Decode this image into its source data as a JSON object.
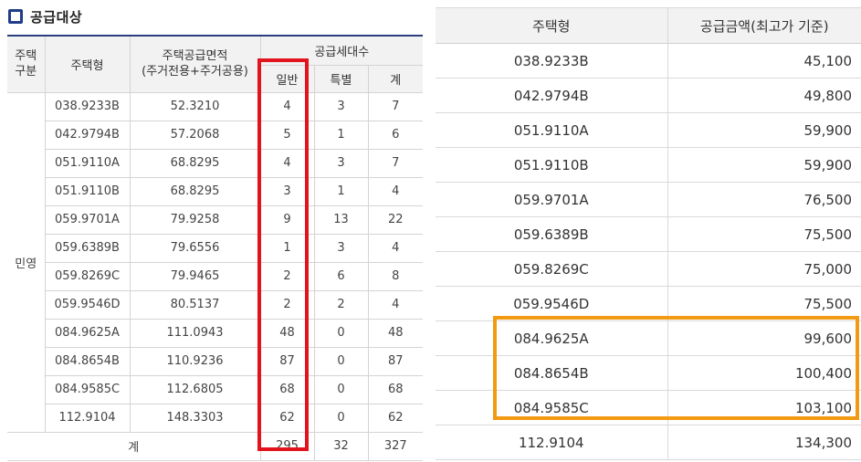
{
  "left": {
    "title": "공급대상",
    "headers": {
      "category": "주택\n구분",
      "type": "주택형",
      "area": "주택공급면적\n(주거전용+주거공용)",
      "units": "공급세대수",
      "general": "일반",
      "special": "특별",
      "total": "계"
    },
    "group_label": "민영",
    "rows": [
      {
        "type": "038.9233B",
        "area": "52.3210",
        "general": "4",
        "special": "3",
        "total": "7"
      },
      {
        "type": "042.9794B",
        "area": "57.2068",
        "general": "5",
        "special": "1",
        "total": "6"
      },
      {
        "type": "051.9110A",
        "area": "68.8295",
        "general": "4",
        "special": "3",
        "total": "7"
      },
      {
        "type": "051.9110B",
        "area": "68.8295",
        "general": "3",
        "special": "1",
        "total": "4"
      },
      {
        "type": "059.9701A",
        "area": "79.9258",
        "general": "9",
        "special": "13",
        "total": "22"
      },
      {
        "type": "059.6389B",
        "area": "79.6556",
        "general": "1",
        "special": "3",
        "total": "4"
      },
      {
        "type": "059.8269C",
        "area": "79.9465",
        "general": "2",
        "special": "6",
        "total": "8"
      },
      {
        "type": "059.9546D",
        "area": "80.5137",
        "general": "2",
        "special": "2",
        "total": "4"
      },
      {
        "type": "084.9625A",
        "area": "111.0943",
        "general": "48",
        "special": "0",
        "total": "48"
      },
      {
        "type": "084.8654B",
        "area": "110.9236",
        "general": "87",
        "special": "0",
        "total": "87"
      },
      {
        "type": "084.9585C",
        "area": "112.6805",
        "general": "68",
        "special": "0",
        "total": "68"
      },
      {
        "type": "112.9104",
        "area": "148.3303",
        "general": "62",
        "special": "0",
        "total": "62"
      }
    ],
    "footer": {
      "label": "계",
      "general": "295",
      "special": "32",
      "total": "327"
    }
  },
  "right": {
    "headers": {
      "type": "주택형",
      "price": "공급금액(최고가 기준)"
    },
    "rows": [
      {
        "type": "038.9233B",
        "price": "45,100"
      },
      {
        "type": "042.9794B",
        "price": "49,800"
      },
      {
        "type": "051.9110A",
        "price": "59,900"
      },
      {
        "type": "051.9110B",
        "price": "59,900"
      },
      {
        "type": "059.9701A",
        "price": "76,500"
      },
      {
        "type": "059.6389B",
        "price": "75,500"
      },
      {
        "type": "059.8269C",
        "price": "75,000"
      },
      {
        "type": "059.9546D",
        "price": "75,500"
      },
      {
        "type": "084.9625A",
        "price": "99,600"
      },
      {
        "type": "084.8654B",
        "price": "100,400"
      },
      {
        "type": "084.9585C",
        "price": "103,100"
      },
      {
        "type": "112.9104",
        "price": "134,300"
      }
    ]
  },
  "highlights": {
    "red": "#e1141e",
    "orange": "#f29a12",
    "title_icon": "#1f3d8a"
  }
}
